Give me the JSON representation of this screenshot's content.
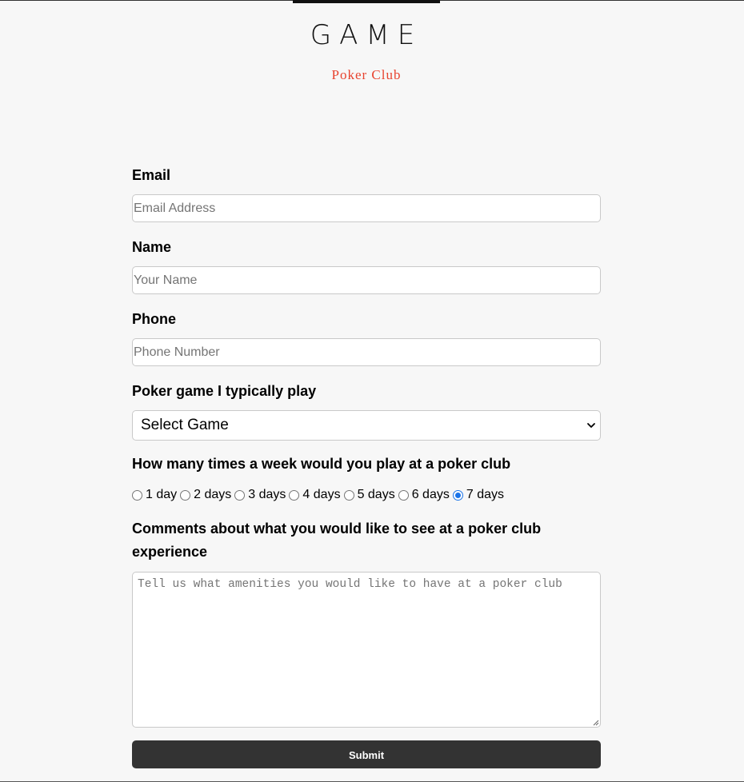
{
  "brand": {
    "title": "GAME",
    "subtitle": "Poker Club"
  },
  "form": {
    "email": {
      "label": "Email",
      "placeholder": "Email Address",
      "value": ""
    },
    "name": {
      "label": "Name",
      "placeholder": "Your Name",
      "value": ""
    },
    "phone": {
      "label": "Phone",
      "placeholder": "Phone Number",
      "value": ""
    },
    "game": {
      "label": "Poker game I typically play",
      "selected": "Select Game"
    },
    "frequency": {
      "label": "How many times a week would you play at a poker club",
      "options": [
        "1 day",
        "2 days",
        "3 days",
        "4 days",
        "5 days",
        "6 days",
        "7 days"
      ],
      "selected_index": 6
    },
    "comments": {
      "label": "Comments about what you would like to see at a poker club experience",
      "placeholder": "Tell us what amenities you would like to have at a poker club",
      "value": ""
    },
    "submit_label": "Submit"
  },
  "colors": {
    "background": "#f7f7f7",
    "accent": "#e8432f",
    "button": "#333333",
    "radio_checked": "#1a73e8"
  },
  "icons": {
    "select_chevron": "chevron-down-icon",
    "textarea_grip": "resize-grip-icon"
  }
}
